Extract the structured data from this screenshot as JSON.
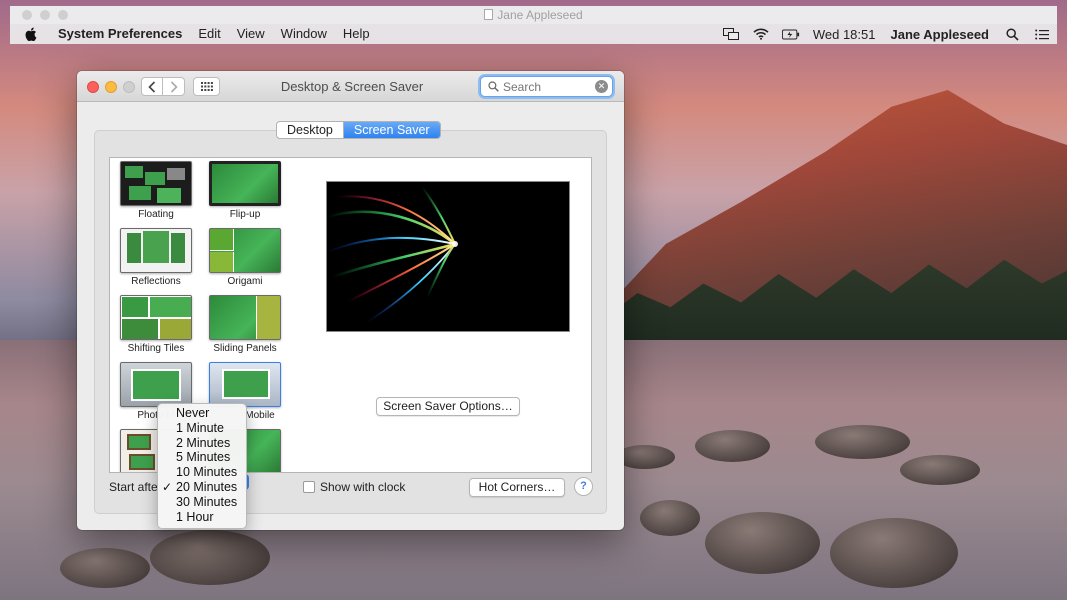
{
  "outer_window": {
    "title": "Jane Appleseed"
  },
  "menubar": {
    "app_name": "System Preferences",
    "items": [
      "Edit",
      "View",
      "Window",
      "Help"
    ],
    "status_icons": [
      "display-mirror-icon",
      "wifi-icon",
      "battery-icon"
    ],
    "clock": "Wed 18:51",
    "user": "Jane Appleseed"
  },
  "window": {
    "title": "Desktop & Screen Saver",
    "search_placeholder": "Search",
    "tabs": [
      {
        "label": "Desktop",
        "active": false
      },
      {
        "label": "Screen Saver",
        "active": true
      }
    ]
  },
  "savers": [
    {
      "label": "Floating"
    },
    {
      "label": "Flip-up"
    },
    {
      "label": "Reflections"
    },
    {
      "label": "Origami"
    },
    {
      "label": "Shifting Tiles"
    },
    {
      "label": "Sliding Panels"
    },
    {
      "label": "Photo M"
    },
    {
      "label": "Mobile"
    }
  ],
  "options_button": "Screen Saver Options…",
  "start_after_label": "Start after",
  "show_clock_label": "Show with clock",
  "hot_corners_button": "Hot Corners…",
  "help_button": "?",
  "dropdown": {
    "selected": "20 Minutes",
    "options": [
      "Never",
      "1 Minute",
      "2 Minutes",
      "5 Minutes",
      "10 Minutes",
      "20 Minutes",
      "30 Minutes",
      "1 Hour"
    ]
  },
  "colors": {
    "accent": "#2e82f0",
    "close": "#fc605b",
    "minimize": "#fdbc40"
  }
}
